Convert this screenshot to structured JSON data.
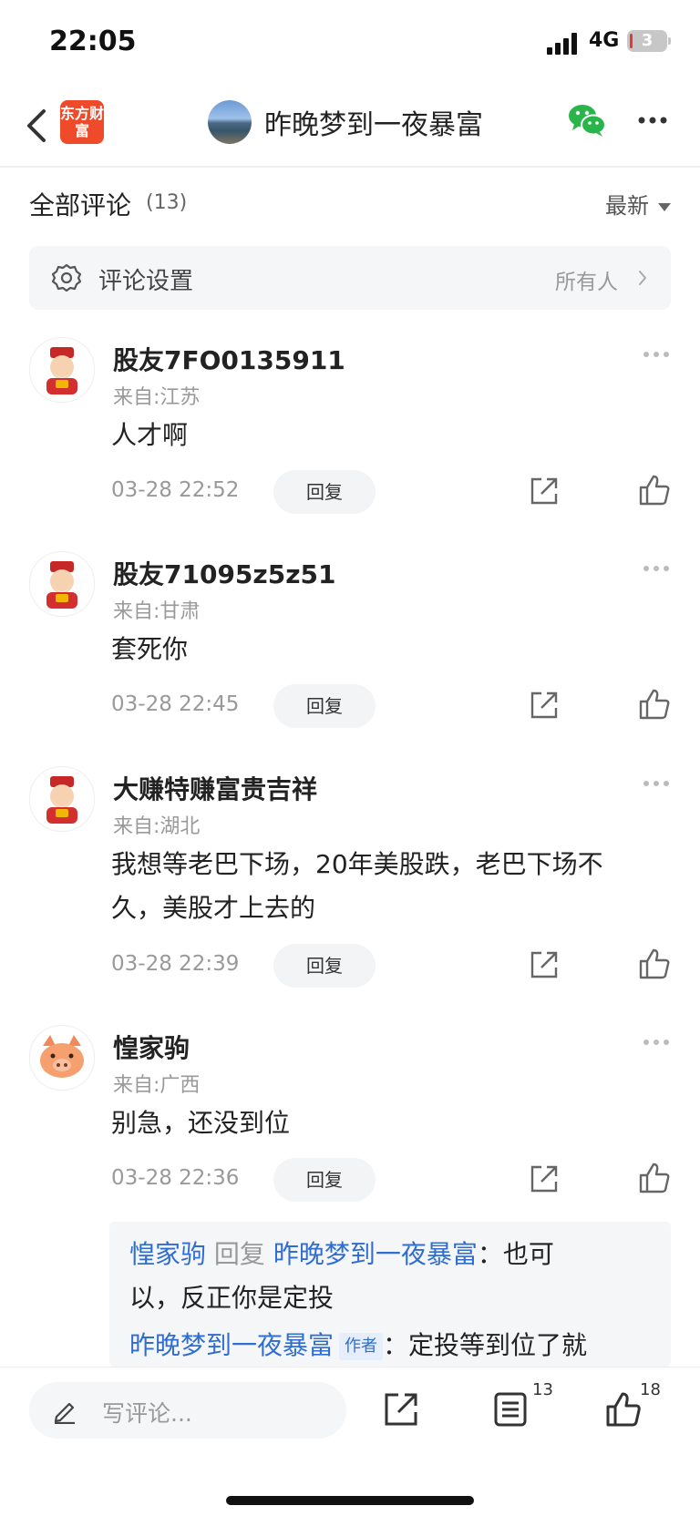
{
  "status_bar": {
    "time": "22:05",
    "network": "4G",
    "battery": "3"
  },
  "nav": {
    "logo_text": "东方财富",
    "title": "昨晚梦到一夜暴富"
  },
  "section": {
    "title": "全部评论",
    "count": "(13)",
    "sort": "最新"
  },
  "settings": {
    "label": "评论设置",
    "value": "所有人"
  },
  "comments": [
    {
      "name": "股友7FO0135911",
      "location": "来自:江苏",
      "text": "人才啊",
      "time": "03-28 22:52",
      "reply": "回复"
    },
    {
      "name": "股友71095z5z51",
      "location": "来自:甘肃",
      "text": "套死你",
      "time": "03-28 22:45",
      "reply": "回复"
    },
    {
      "name": "大赚特赚富贵吉祥",
      "location": "来自:湖北",
      "text_line1": "我想等老巴下场，20年美股跌，老巴下场不",
      "text_line2": "久，美股才上去的",
      "time": "03-28 22:39",
      "reply": "回复"
    },
    {
      "name": "惶家驹",
      "location": "来自:广西",
      "text": "别急，还没到位",
      "time": "03-28 22:36",
      "reply": "回复"
    }
  ],
  "replies": [
    {
      "from": "惶家驹",
      "verb": "回复",
      "to": "昨晚梦到一夜暴富",
      "sep": "：",
      "text_line1": "也可",
      "text_line2": "以，反正你是定投"
    },
    {
      "from": "昨晚梦到一夜暴富",
      "badge": "作者",
      "sep": "：",
      "text": "定投等到位了就"
    }
  ],
  "bottom_bar": {
    "placeholder": "写评论...",
    "comment_count": "13",
    "like_count": "18"
  },
  "colors": {
    "brand": "#ef4b2b",
    "link": "#2f6dd0",
    "wechat": "#2ab54b"
  }
}
